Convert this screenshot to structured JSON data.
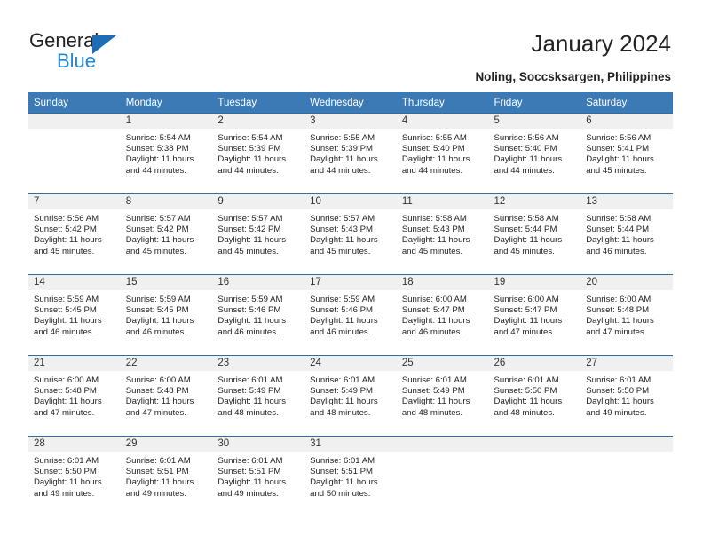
{
  "logo": {
    "word1": "General",
    "word2": "Blue",
    "triangle_color": "#1f6db5",
    "blue_color": "#2288d6"
  },
  "header": {
    "title": "January 2024",
    "subtitle": "Noling, Soccsksargen, Philippines"
  },
  "theme": {
    "header_bg": "#3b7ab5",
    "separator": "#2c6ca8",
    "daynum_bg": "#f0f0f0"
  },
  "weekdays": [
    "Sunday",
    "Monday",
    "Tuesday",
    "Wednesday",
    "Thursday",
    "Friday",
    "Saturday"
  ],
  "weeks": [
    [
      {
        "day": "",
        "sunrise": "",
        "sunset": "",
        "daylight1": "",
        "daylight2": ""
      },
      {
        "day": "1",
        "sunrise": "Sunrise: 5:54 AM",
        "sunset": "Sunset: 5:38 PM",
        "daylight1": "Daylight: 11 hours",
        "daylight2": "and 44 minutes."
      },
      {
        "day": "2",
        "sunrise": "Sunrise: 5:54 AM",
        "sunset": "Sunset: 5:39 PM",
        "daylight1": "Daylight: 11 hours",
        "daylight2": "and 44 minutes."
      },
      {
        "day": "3",
        "sunrise": "Sunrise: 5:55 AM",
        "sunset": "Sunset: 5:39 PM",
        "daylight1": "Daylight: 11 hours",
        "daylight2": "and 44 minutes."
      },
      {
        "day": "4",
        "sunrise": "Sunrise: 5:55 AM",
        "sunset": "Sunset: 5:40 PM",
        "daylight1": "Daylight: 11 hours",
        "daylight2": "and 44 minutes."
      },
      {
        "day": "5",
        "sunrise": "Sunrise: 5:56 AM",
        "sunset": "Sunset: 5:40 PM",
        "daylight1": "Daylight: 11 hours",
        "daylight2": "and 44 minutes."
      },
      {
        "day": "6",
        "sunrise": "Sunrise: 5:56 AM",
        "sunset": "Sunset: 5:41 PM",
        "daylight1": "Daylight: 11 hours",
        "daylight2": "and 45 minutes."
      }
    ],
    [
      {
        "day": "7",
        "sunrise": "Sunrise: 5:56 AM",
        "sunset": "Sunset: 5:42 PM",
        "daylight1": "Daylight: 11 hours",
        "daylight2": "and 45 minutes."
      },
      {
        "day": "8",
        "sunrise": "Sunrise: 5:57 AM",
        "sunset": "Sunset: 5:42 PM",
        "daylight1": "Daylight: 11 hours",
        "daylight2": "and 45 minutes."
      },
      {
        "day": "9",
        "sunrise": "Sunrise: 5:57 AM",
        "sunset": "Sunset: 5:42 PM",
        "daylight1": "Daylight: 11 hours",
        "daylight2": "and 45 minutes."
      },
      {
        "day": "10",
        "sunrise": "Sunrise: 5:57 AM",
        "sunset": "Sunset: 5:43 PM",
        "daylight1": "Daylight: 11 hours",
        "daylight2": "and 45 minutes."
      },
      {
        "day": "11",
        "sunrise": "Sunrise: 5:58 AM",
        "sunset": "Sunset: 5:43 PM",
        "daylight1": "Daylight: 11 hours",
        "daylight2": "and 45 minutes."
      },
      {
        "day": "12",
        "sunrise": "Sunrise: 5:58 AM",
        "sunset": "Sunset: 5:44 PM",
        "daylight1": "Daylight: 11 hours",
        "daylight2": "and 45 minutes."
      },
      {
        "day": "13",
        "sunrise": "Sunrise: 5:58 AM",
        "sunset": "Sunset: 5:44 PM",
        "daylight1": "Daylight: 11 hours",
        "daylight2": "and 46 minutes."
      }
    ],
    [
      {
        "day": "14",
        "sunrise": "Sunrise: 5:59 AM",
        "sunset": "Sunset: 5:45 PM",
        "daylight1": "Daylight: 11 hours",
        "daylight2": "and 46 minutes."
      },
      {
        "day": "15",
        "sunrise": "Sunrise: 5:59 AM",
        "sunset": "Sunset: 5:45 PM",
        "daylight1": "Daylight: 11 hours",
        "daylight2": "and 46 minutes."
      },
      {
        "day": "16",
        "sunrise": "Sunrise: 5:59 AM",
        "sunset": "Sunset: 5:46 PM",
        "daylight1": "Daylight: 11 hours",
        "daylight2": "and 46 minutes."
      },
      {
        "day": "17",
        "sunrise": "Sunrise: 5:59 AM",
        "sunset": "Sunset: 5:46 PM",
        "daylight1": "Daylight: 11 hours",
        "daylight2": "and 46 minutes."
      },
      {
        "day": "18",
        "sunrise": "Sunrise: 6:00 AM",
        "sunset": "Sunset: 5:47 PM",
        "daylight1": "Daylight: 11 hours",
        "daylight2": "and 46 minutes."
      },
      {
        "day": "19",
        "sunrise": "Sunrise: 6:00 AM",
        "sunset": "Sunset: 5:47 PM",
        "daylight1": "Daylight: 11 hours",
        "daylight2": "and 47 minutes."
      },
      {
        "day": "20",
        "sunrise": "Sunrise: 6:00 AM",
        "sunset": "Sunset: 5:48 PM",
        "daylight1": "Daylight: 11 hours",
        "daylight2": "and 47 minutes."
      }
    ],
    [
      {
        "day": "21",
        "sunrise": "Sunrise: 6:00 AM",
        "sunset": "Sunset: 5:48 PM",
        "daylight1": "Daylight: 11 hours",
        "daylight2": "and 47 minutes."
      },
      {
        "day": "22",
        "sunrise": "Sunrise: 6:00 AM",
        "sunset": "Sunset: 5:48 PM",
        "daylight1": "Daylight: 11 hours",
        "daylight2": "and 47 minutes."
      },
      {
        "day": "23",
        "sunrise": "Sunrise: 6:01 AM",
        "sunset": "Sunset: 5:49 PM",
        "daylight1": "Daylight: 11 hours",
        "daylight2": "and 48 minutes."
      },
      {
        "day": "24",
        "sunrise": "Sunrise: 6:01 AM",
        "sunset": "Sunset: 5:49 PM",
        "daylight1": "Daylight: 11 hours",
        "daylight2": "and 48 minutes."
      },
      {
        "day": "25",
        "sunrise": "Sunrise: 6:01 AM",
        "sunset": "Sunset: 5:49 PM",
        "daylight1": "Daylight: 11 hours",
        "daylight2": "and 48 minutes."
      },
      {
        "day": "26",
        "sunrise": "Sunrise: 6:01 AM",
        "sunset": "Sunset: 5:50 PM",
        "daylight1": "Daylight: 11 hours",
        "daylight2": "and 48 minutes."
      },
      {
        "day": "27",
        "sunrise": "Sunrise: 6:01 AM",
        "sunset": "Sunset: 5:50 PM",
        "daylight1": "Daylight: 11 hours",
        "daylight2": "and 49 minutes."
      }
    ],
    [
      {
        "day": "28",
        "sunrise": "Sunrise: 6:01 AM",
        "sunset": "Sunset: 5:50 PM",
        "daylight1": "Daylight: 11 hours",
        "daylight2": "and 49 minutes."
      },
      {
        "day": "29",
        "sunrise": "Sunrise: 6:01 AM",
        "sunset": "Sunset: 5:51 PM",
        "daylight1": "Daylight: 11 hours",
        "daylight2": "and 49 minutes."
      },
      {
        "day": "30",
        "sunrise": "Sunrise: 6:01 AM",
        "sunset": "Sunset: 5:51 PM",
        "daylight1": "Daylight: 11 hours",
        "daylight2": "and 49 minutes."
      },
      {
        "day": "31",
        "sunrise": "Sunrise: 6:01 AM",
        "sunset": "Sunset: 5:51 PM",
        "daylight1": "Daylight: 11 hours",
        "daylight2": "and 50 minutes."
      },
      {
        "day": "",
        "sunrise": "",
        "sunset": "",
        "daylight1": "",
        "daylight2": ""
      },
      {
        "day": "",
        "sunrise": "",
        "sunset": "",
        "daylight1": "",
        "daylight2": ""
      },
      {
        "day": "",
        "sunrise": "",
        "sunset": "",
        "daylight1": "",
        "daylight2": ""
      }
    ]
  ]
}
